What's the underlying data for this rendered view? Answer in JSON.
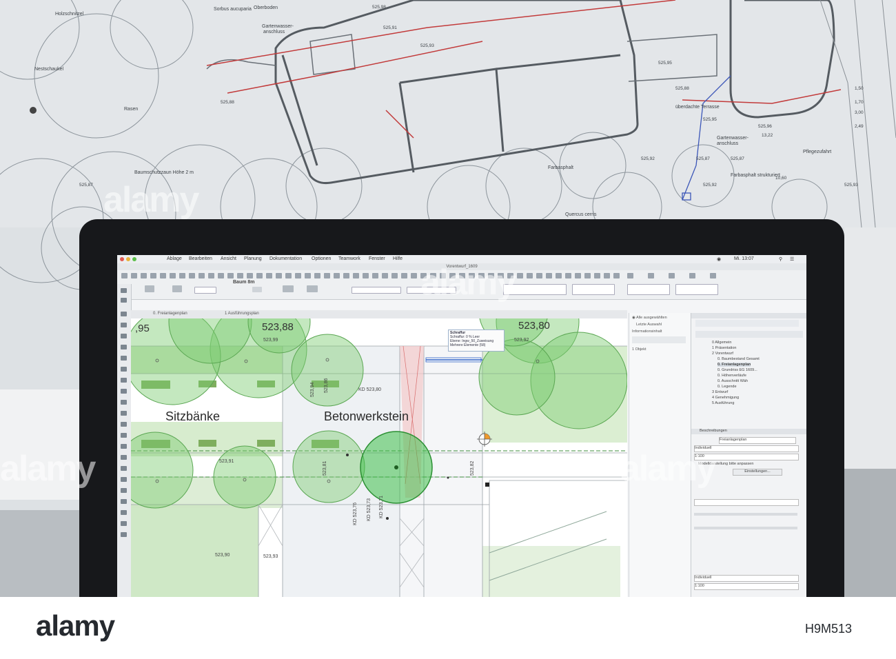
{
  "screen": {
    "menu": [
      "Ablage",
      "Bearbeiten",
      "Ansicht",
      "Planung",
      "Dokumentation",
      "Optionen",
      "Teamwork",
      "Fenster",
      "Hilfe"
    ],
    "window_title": "Vorentwurf_1609",
    "clock": "Mi. 13:07",
    "toolbar_label": "Baum 8m",
    "tabs": [
      "0. Freianlagenplan",
      "1 Ausführungsplan"
    ],
    "canvas": {
      "label_left": "Sitzbänke",
      "label_center": "Betonwerkstein",
      "elev_1": "523,88",
      "elev_2": "523,80",
      "edge_value": ",95",
      "small_values": [
        "523,99",
        "523,92",
        "KD 523,80",
        "523,91",
        "523,90",
        "523,93",
        "KD 523,76",
        "KD 523,73",
        "KD 523,71",
        "523,81",
        "523,82",
        "523,94",
        "523,86"
      ],
      "tooltip": [
        "Schraffur",
        "Schraffur: 0 % Leer",
        "Ebene: Ingw_50_Zuweisung",
        "Mehrere Elemente (58)"
      ]
    },
    "panel_mid": [
      "Alle ausgewählten",
      "Letzte Auswahl",
      "Informationsinhalt",
      "1 Objekt"
    ],
    "tree": [
      "0 Allgemein",
      "1 Präsentation",
      "2 Vorentwurf",
      "0. Baumbestand Gesamt",
      "0. Freianlagenplan",
      "0. Grundriss EG 1609...",
      "0. Höhenverläufe",
      "0. Ausschnitt Wäh",
      "0. Legende",
      "3 Entwurf",
      "4 Genehmigung",
      "5 Ausführung"
    ],
    "props": [
      "Beschreibungen",
      "Freianlagenplan",
      "Individuell",
      "1:100",
      "Modelldarstellung bitte anpassen",
      "Einstellungen..."
    ]
  },
  "watermark": {
    "logo": "alamy",
    "image_id": "H9M513"
  },
  "colors": {
    "tree_fill": "#7ccc72",
    "blueprint_red": "#c23a3a",
    "monitor_bezel": "#17181b"
  }
}
